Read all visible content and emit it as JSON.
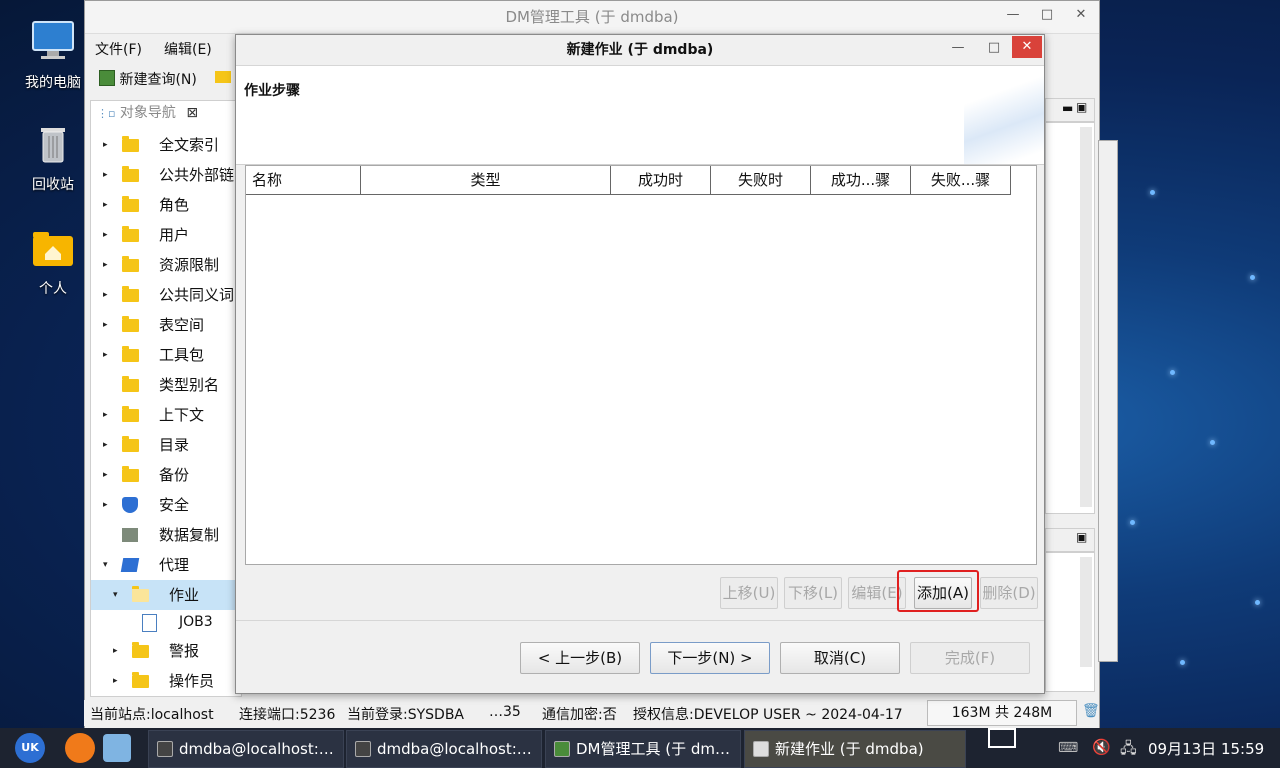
{
  "desktop": {
    "icons": [
      {
        "label": "我的电脑"
      },
      {
        "label": "回收站"
      },
      {
        "label": "个人"
      }
    ]
  },
  "main_window": {
    "title": "DM管理工具 (于 dmdba)",
    "menu": [
      "文件(F)",
      "编辑(E)"
    ],
    "toolbar": {
      "new_query": "新建查询(N)"
    },
    "nav_tab": "对象导航",
    "tree": [
      {
        "label": "全文索引",
        "arrow": "▸"
      },
      {
        "label": "公共外部链",
        "arrow": "▸"
      },
      {
        "label": "角色",
        "arrow": "▸"
      },
      {
        "label": "用户",
        "arrow": "▸"
      },
      {
        "label": "资源限制",
        "arrow": "▸"
      },
      {
        "label": "公共同义词",
        "arrow": "▸"
      },
      {
        "label": "表空间",
        "arrow": "▸"
      },
      {
        "label": "工具包",
        "arrow": "▸"
      },
      {
        "label": "类型别名",
        "arrow": ""
      },
      {
        "label": "上下文",
        "arrow": "▸"
      },
      {
        "label": "目录",
        "arrow": "▸"
      },
      {
        "label": "备份",
        "arrow": "▸"
      },
      {
        "label": "安全",
        "arrow": "▸"
      },
      {
        "label": "数据复制",
        "arrow": ""
      },
      {
        "label": "代理",
        "arrow": "▾"
      },
      {
        "label": "作业",
        "arrow": "▾"
      },
      {
        "label": "JOB3",
        "arrow": ""
      },
      {
        "label": "警报",
        "arrow": "▸"
      },
      {
        "label": "操作员",
        "arrow": "▸"
      }
    ],
    "status": {
      "site": "当前站点:localhost",
      "port": "连接端口:5236",
      "login": "当前登录:SYSDBA",
      "ellipsis": "…35",
      "encrypt": "通信加密:否",
      "license": "授权信息:DEVELOP USER ~ 2024-04-17",
      "memory": "163M 共 248M"
    }
  },
  "dialog": {
    "title": "新建作业  (于 dmdba)",
    "step_title": "作业步骤",
    "columns": [
      "名称",
      "类型",
      "成功时",
      "失败时",
      "成功...骤",
      "失败...骤"
    ],
    "buttons": {
      "up": "上移(U)",
      "down": "下移(L)",
      "edit": "编辑(E)",
      "add": "添加(A)",
      "delete": "删除(D)",
      "prev": "< 上一步(B)",
      "next": "下一步(N) >",
      "cancel": "取消(C)",
      "finish": "完成(F)"
    },
    "highlight_color": "#e02020"
  },
  "taskbar": {
    "tasks": [
      {
        "label": "dmdba@localhost:…"
      },
      {
        "label": "dmdba@localhost:…"
      },
      {
        "label": "DM管理工具 (于 dm…"
      },
      {
        "label": "新建作业  (于 dmdba)"
      }
    ],
    "clock": "09月13日 15:59"
  }
}
